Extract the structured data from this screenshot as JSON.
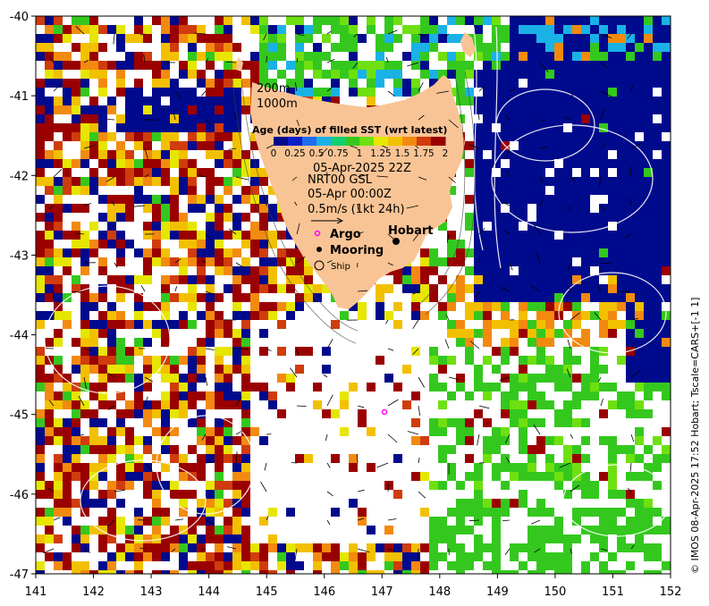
{
  "map": {
    "longitude_ticks": [
      "141",
      "142",
      "143",
      "144",
      "145",
      "146",
      "147",
      "148",
      "149",
      "150",
      "151",
      "152"
    ],
    "latitude_ticks": [
      "-40",
      "-41",
      "-42",
      "-43",
      "-44",
      "-45",
      "-46",
      "-47"
    ],
    "extent": {
      "lon": [
        141,
        152
      ],
      "lat": [
        -47,
        -40
      ]
    },
    "land_color": "#f9c495",
    "colorbar": {
      "title": "Age (days) of filled SST (wrt latest)",
      "tick_labels": [
        "0",
        "0.25",
        "0.5",
        "0.75",
        "1",
        "1.25",
        "1.5",
        "1.75",
        "2"
      ],
      "colors": [
        "#000a8c",
        "#0a1fc8",
        "#1e6cf0",
        "#1ab2e6",
        "#10d070",
        "#34c81e",
        "#6ee010",
        "#e6e600",
        "#f2c000",
        "#f28a10",
        "#d03c0c",
        "#9a0000"
      ]
    },
    "image_time": "05-Apr-2025 22Z",
    "bathymetry_labels": [
      "200m",
      "1000m"
    ],
    "currents": {
      "source": "NRT00 GSL",
      "time": "05-Apr 00:00Z",
      "scale_label": "0.5m/s (1kt 24h)"
    },
    "legend": {
      "argo": "Argo",
      "mooring": "Mooring",
      "ship": "Ship"
    },
    "place_label": "Hobart",
    "credit": "© IMOS 08-Apr-2025 17:52 Hobart; Tscale=CARS+[-1 1]"
  }
}
